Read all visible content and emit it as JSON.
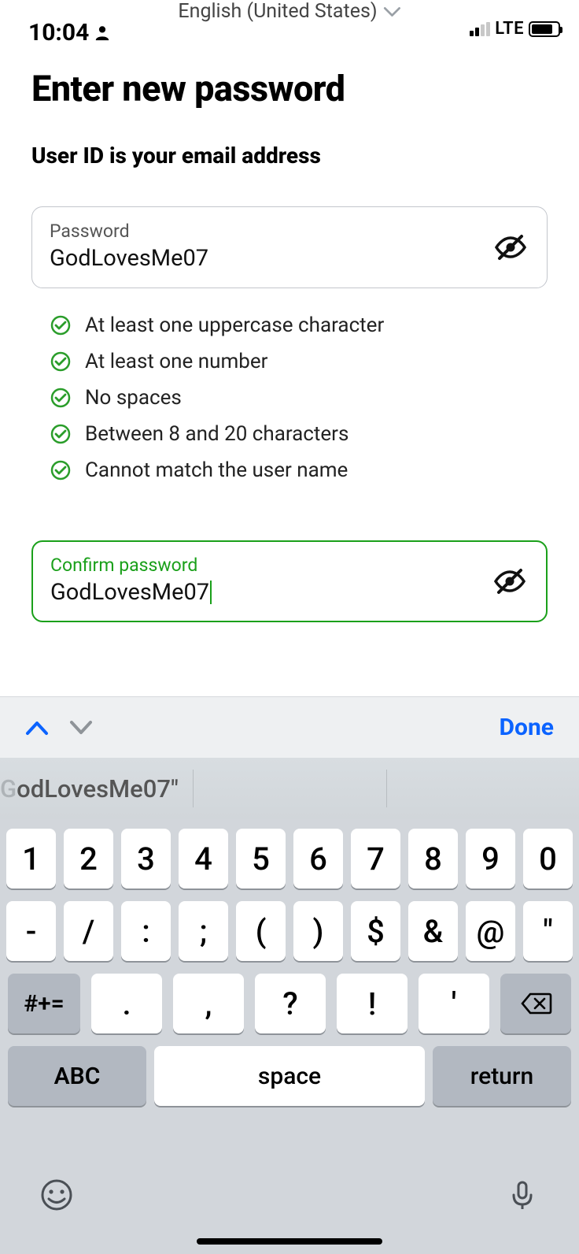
{
  "status": {
    "time": "10:04",
    "language": "English (United States)",
    "network": "LTE"
  },
  "page": {
    "title": "Enter new password",
    "subtitle": "User ID is your email address"
  },
  "passwordField": {
    "label": "Password",
    "value": "GodLovesMe07"
  },
  "rules": [
    "At least one uppercase character",
    "At least one number",
    "No spaces",
    "Between 8 and 20 characters",
    "Cannot match the user name"
  ],
  "confirmField": {
    "label": "Confirm password",
    "value": "GodLovesMe07"
  },
  "kbdAccessory": {
    "done": "Done"
  },
  "suggestion": {
    "text": "odLovesMe07\"",
    "leadGray": "G"
  },
  "keyboard": {
    "row1": [
      "1",
      "2",
      "3",
      "4",
      "5",
      "6",
      "7",
      "8",
      "9",
      "0"
    ],
    "row2": [
      "-",
      "/",
      ":",
      ";",
      "(",
      ")",
      "$",
      "&",
      "@",
      "\""
    ],
    "row3Mod": "#+=",
    "row3": [
      ".",
      ",",
      "?",
      "!",
      "'"
    ],
    "abc": "ABC",
    "space": "space",
    "ret": "return"
  }
}
